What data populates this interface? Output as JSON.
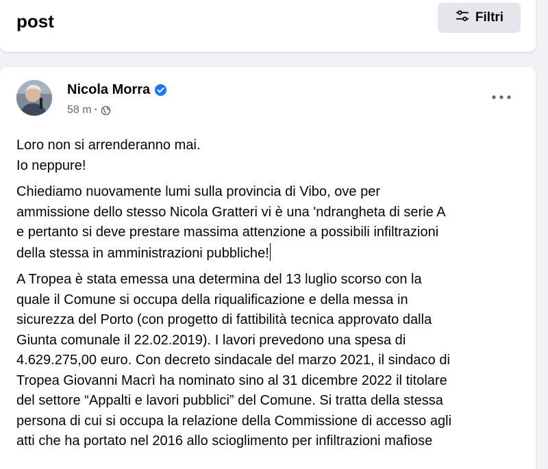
{
  "header": {
    "title": "post",
    "filter_label": "Filtri",
    "filter_icon": "sliders-icon"
  },
  "post": {
    "author": "Nicola Morra",
    "verified": true,
    "timestamp": "58 m",
    "separator": "·",
    "audience_icon": "globe-icon",
    "more_icon": "more-horizontal-icon",
    "paragraphs": [
      {
        "lines": [
          "Loro non si arrenderanno mai.",
          "Io neppure!"
        ]
      },
      {
        "lines": [
          "Chiediamo nuovamente lumi sulla provincia di Vibo, ove per",
          "ammissione dello stesso Nicola Gratteri vi è una 'ndrangheta di serie A",
          "e pertanto si deve prestare massima attenzione a possibili infiltrazioni",
          "della stessa in amministrazioni pubbliche!"
        ]
      },
      {
        "lines": [
          "A Tropea è stata emessa una determina del 13 luglio scorso con la",
          "quale il Comune si occupa della riqualificazione e della messa in",
          "sicurezza del Porto (con progetto di fattibilità tecnica approvato dalla",
          "Giunta comunale il 22.02.2019). I lavori prevedono una spesa di",
          "4.629.275,00 euro. Con decreto sindacale del marzo 2021, il sindaco di",
          "Tropea Giovanni Macrì ha nominato sino al 31 dicembre 2022 il titolare",
          "del settore “Appalti e lavori pubblici” del Comune. Si tratta della stessa",
          "persona di cui si occupa la relazione della Commissione di accesso agli",
          "atti che ha portato nel 2016 allo scioglimento per infiltrazioni mafiose"
        ]
      }
    ]
  },
  "colors": {
    "page_background": "#f0f2f5",
    "card_background": "#ffffff",
    "button_background": "#e4e6eb",
    "verified_blue": "#1877f2",
    "secondary_text": "#65676b"
  }
}
